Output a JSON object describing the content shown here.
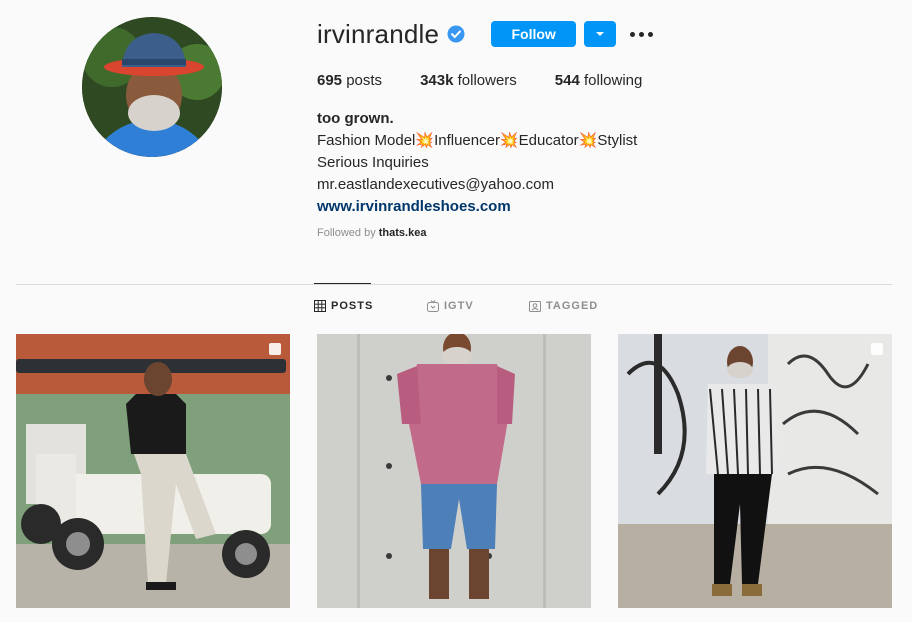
{
  "profile": {
    "username": "irvinrandle",
    "follow_label": "Follow"
  },
  "stats": {
    "posts_count": "695",
    "posts_label": "posts",
    "followers_count": "343k",
    "followers_label": "followers",
    "following_count": "544",
    "following_label": "following"
  },
  "bio": {
    "name": "too grown.",
    "line1": "Fashion Model💥Influencer💥Educator💥Stylist",
    "line2": "Serious Inquiries",
    "email": "mr.eastlandexecutives@yahoo.com",
    "website": "www.irvinrandleshoes.com",
    "followed_by_prefix": "Followed by ",
    "followed_by_user": "thats.kea"
  },
  "tabs": [
    {
      "label": "POSTS",
      "icon": "grid-icon",
      "active": true
    },
    {
      "label": "IGTV",
      "icon": "igtv-icon",
      "active": false
    },
    {
      "label": "TAGGED",
      "icon": "tagged-icon",
      "active": false
    }
  ],
  "colors": {
    "accent": "#0095f6",
    "link": "#00376b",
    "verified": "#3897f0"
  }
}
